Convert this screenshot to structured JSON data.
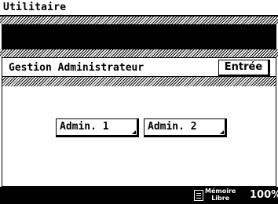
{
  "title": "Utilitaire",
  "message": "",
  "panel": {
    "title": "Gestion Administrateur",
    "enter_label": "Entrée",
    "buttons": [
      {
        "label": "Admin. 1"
      },
      {
        "label": "Admin. 2"
      }
    ]
  },
  "status": {
    "memory_label_line1": "Mémoire",
    "memory_label_line2": "Libre",
    "memory_value": "100%",
    "memory_icon": "memory-icon"
  },
  "colors": {
    "background": "#ffffff",
    "foreground": "#000000"
  }
}
